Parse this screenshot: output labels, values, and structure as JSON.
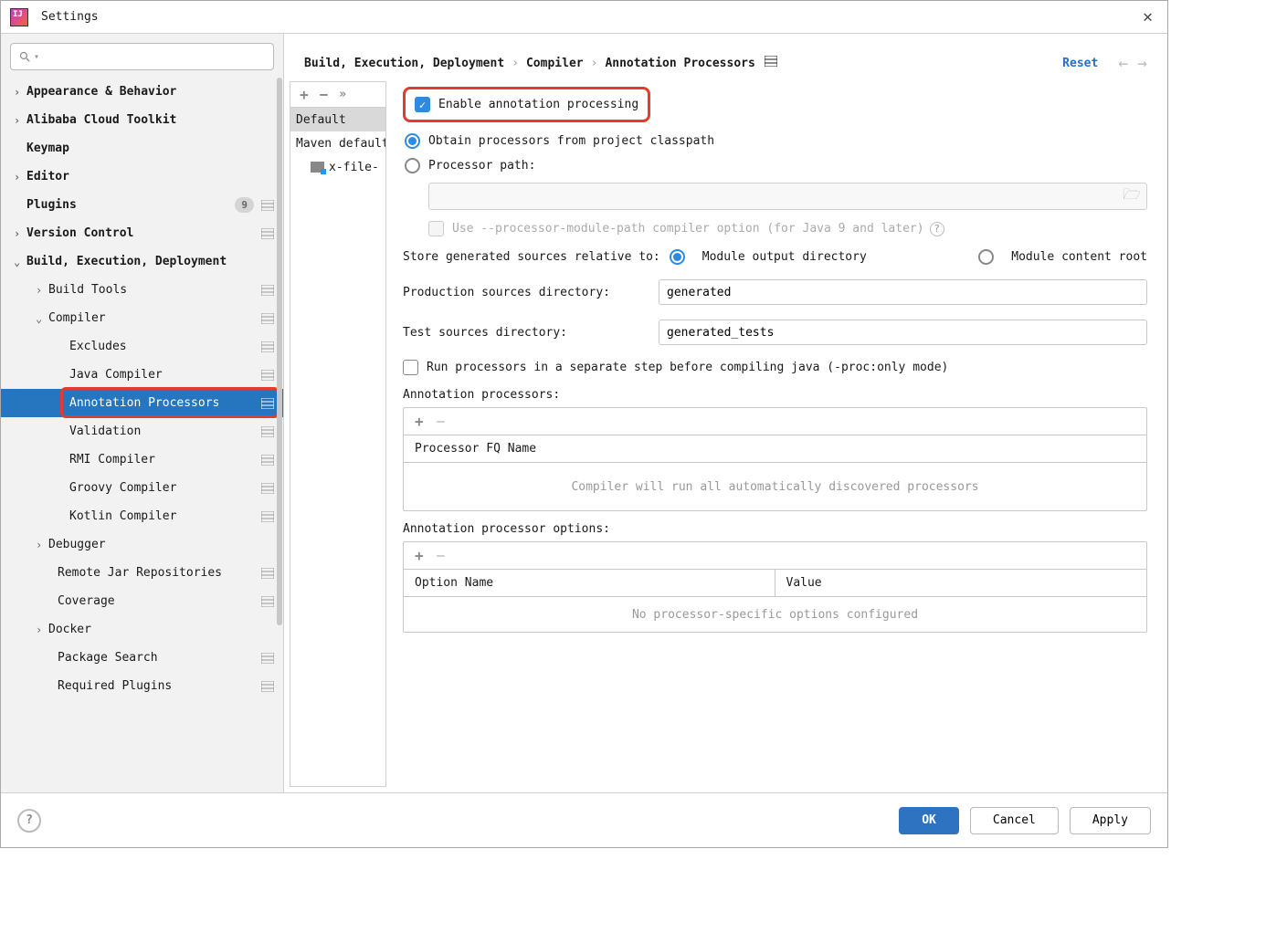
{
  "window": {
    "title": "Settings"
  },
  "header": {
    "crumb1": "Build, Execution, Deployment",
    "crumb2": "Compiler",
    "crumb3": "Annotation Processors",
    "reset": "Reset"
  },
  "sidebar": {
    "items": {
      "appearance": "Appearance & Behavior",
      "alibaba": "Alibaba Cloud Toolkit",
      "keymap": "Keymap",
      "editor": "Editor",
      "plugins": "Plugins",
      "plugins_badge": "9",
      "vcs": "Version Control",
      "build": "Build, Execution, Deployment",
      "build_tools": "Build Tools",
      "compiler": "Compiler",
      "excludes": "Excludes",
      "java_compiler": "Java Compiler",
      "annotation_processors": "Annotation Processors",
      "validation": "Validation",
      "rmi": "RMI Compiler",
      "groovy": "Groovy Compiler",
      "kotlin": "Kotlin Compiler",
      "debugger": "Debugger",
      "remote_jar": "Remote Jar Repositories",
      "coverage": "Coverage",
      "docker": "Docker",
      "package_search": "Package Search",
      "required_plugins": "Required Plugins"
    }
  },
  "profiles": {
    "default": "Default",
    "maven": "Maven default",
    "xfile": "x-file-"
  },
  "form": {
    "enable": "Enable annotation processing",
    "obtain": "Obtain processors from project classpath",
    "processor_path": "Processor path:",
    "module_path": "Use --processor-module-path compiler option (for Java 9 and later)",
    "store_relative": "Store generated sources relative to:",
    "module_output": "Module output directory",
    "module_content": "Module content root",
    "prod_dir_label": "Production sources directory:",
    "prod_dir_value": "generated",
    "test_dir_label": "Test sources directory:",
    "test_dir_value": "generated_tests",
    "run_separate": "Run processors in a separate step before compiling java (-proc:only mode)",
    "ann_processors": "Annotation processors:",
    "fq_name": "Processor FQ Name",
    "fq_placeholder": "Compiler will run all automatically discovered processors",
    "ann_options": "Annotation processor options:",
    "option_name": "Option Name",
    "value": "Value",
    "opt_placeholder": "No processor-specific options configured"
  },
  "footer": {
    "ok": "OK",
    "cancel": "Cancel",
    "apply": "Apply"
  }
}
